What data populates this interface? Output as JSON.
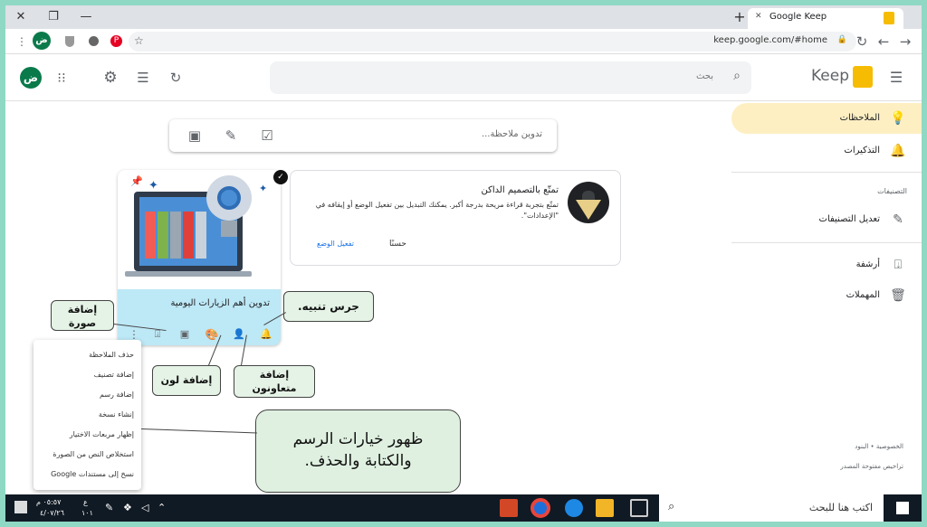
{
  "browser": {
    "tab_title": "Google Keep",
    "url": "keep.google.com/#home",
    "new_tab": "+",
    "close": "✕",
    "restore": "❐",
    "minimize": "—",
    "profile_letter": "ض"
  },
  "header": {
    "app_name": "Keep",
    "search_placeholder": "بحث",
    "avatar_letter": "ض"
  },
  "sidebar": {
    "items": [
      {
        "label": "الملاحظات",
        "icon": "lightbulb-icon"
      },
      {
        "label": "التذكيرات",
        "icon": "bell-icon"
      },
      {
        "label": "تعديل التصنيفات",
        "icon": "pencil-icon"
      },
      {
        "label": "أرشفة",
        "icon": "archive-icon"
      },
      {
        "label": "المهملات",
        "icon": "trash-icon"
      }
    ],
    "section_label": "التصنيفات",
    "footer_privacy": "الخصوصية",
    "footer_dot": "•",
    "footer_terms": "البنود",
    "footer_licenses": "تراخيص مفتوحة المصدر"
  },
  "take_note": {
    "placeholder": "تدوين ملاحظة..."
  },
  "promo": {
    "title": "تمتّع بالتصميم الداكن",
    "body": "تمتّع بتجربة قراءة مريحة بدرجة أكبر. يمكنك التبديل بين تفعيل الوضع أو إيقافه في \"الإعدادات\".",
    "ok": "حسنًا",
    "enable": "تفعيل الوضع"
  },
  "note": {
    "title": "تدوين أهم الزيارات اليومية"
  },
  "menu": {
    "items": [
      "حذف الملاحظة",
      "إضافة تصنيف",
      "إضافة رسم",
      "إنشاء نسخة",
      "إظهار مربعات الاختيار",
      "استخلاص النص من الصورة",
      "نسخ إلى مستندات Google"
    ]
  },
  "callouts": {
    "add_image": "إضافة\nصورة",
    "reminder": "جرس تنبيه.",
    "add_color": "إضافة لون",
    "add_collaborator": "إضافة\nمتعاونون",
    "options": "ظهور خيارات الرسم\nوالكتابة والحذف."
  },
  "taskbar": {
    "search": "اكتب هنا للبحث",
    "time": "٠٥:٥٧ م",
    "date": "٤/٠٧/٢٦",
    "lang": "ع",
    "num": "١٠١"
  },
  "colors": {
    "frame": "#8fd8c4",
    "active_nav": "#feefc3",
    "note": "#bde8f6",
    "callout": "#e5f3e6",
    "taskbar": "#101a24",
    "keep_yellow": "#f6bc04"
  }
}
